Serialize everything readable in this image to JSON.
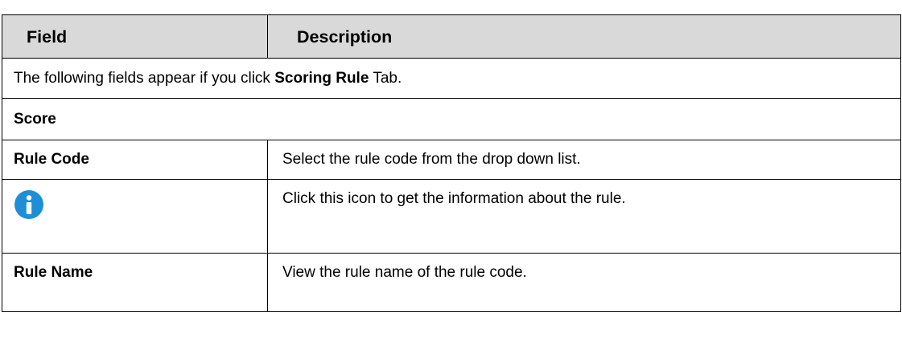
{
  "header": {
    "field_label": "Field",
    "description_label": "Description"
  },
  "note": {
    "prefix": "The following fields appear if you click ",
    "bold": "Scoring Rule",
    "suffix": " Tab."
  },
  "section": {
    "title": "Score"
  },
  "rows": [
    {
      "field": "Rule Code",
      "description": "Select the rule code from the drop down list."
    },
    {
      "icon": "info-icon",
      "description": "Click this icon to get the information about the rule."
    },
    {
      "field": "Rule Name",
      "description": "View the rule name of the rule code."
    }
  ],
  "colors": {
    "header_background": "#d9d9d9",
    "info_icon": "#1e8fd6"
  }
}
